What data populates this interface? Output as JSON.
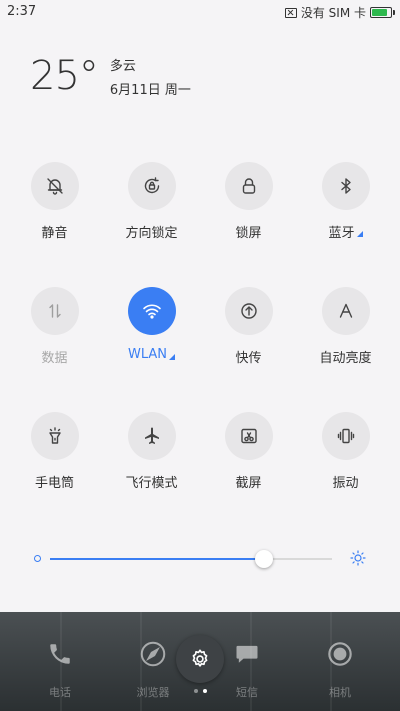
{
  "status_bar": {
    "time": "2:37",
    "sim_text": "没有 SIM 卡",
    "battery_level": 0.85,
    "battery_color": "#2db84d"
  },
  "weather": {
    "temperature": "25°",
    "condition": "多云",
    "date": "6月11日 周一"
  },
  "quick_settings": {
    "accent_color": "#3a7ef3",
    "tiles": [
      {
        "label": "静音",
        "icon": "bell-off-icon",
        "active": false
      },
      {
        "label": "方向锁定",
        "icon": "rotation-lock-icon",
        "active": false
      },
      {
        "label": "锁屏",
        "icon": "lock-icon",
        "active": false
      },
      {
        "label": "蓝牙",
        "icon": "bluetooth-icon",
        "active": false
      },
      {
        "label": "数据",
        "icon": "mobile-data-icon",
        "active": false
      },
      {
        "label": "WLAN",
        "icon": "wifi-icon",
        "active": true
      },
      {
        "label": "快传",
        "icon": "quick-transfer-icon",
        "active": false
      },
      {
        "label": "自动亮度",
        "icon": "auto-brightness-icon",
        "active": false
      },
      {
        "label": "手电筒",
        "icon": "flashlight-icon",
        "active": false
      },
      {
        "label": "飞行模式",
        "icon": "airplane-icon",
        "active": false
      },
      {
        "label": "截屏",
        "icon": "screenshot-icon",
        "active": false
      },
      {
        "label": "振动",
        "icon": "vibrate-icon",
        "active": false
      }
    ]
  },
  "brightness": {
    "level": 0.76
  },
  "home_screen": {
    "apps": [
      {
        "label": "电话",
        "icon": "phone-icon",
        "color": "#3a9e6b"
      },
      {
        "label": "浏览器",
        "icon": "compass-icon",
        "color": "#3a7ef3"
      },
      {
        "label": "短信",
        "icon": "message-icon",
        "color": "#e07a43"
      },
      {
        "label": "相机",
        "icon": "camera-icon",
        "color": "#222222"
      }
    ],
    "page_count": 2,
    "current_page": 2
  }
}
